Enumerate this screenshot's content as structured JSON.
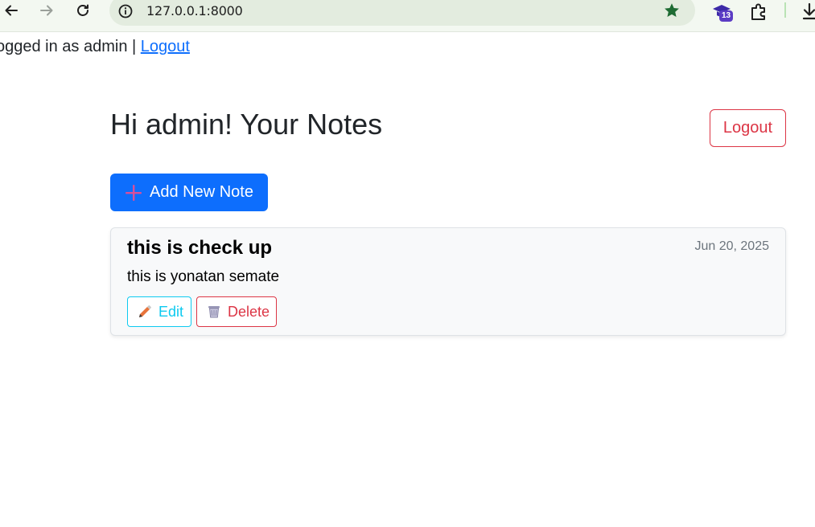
{
  "browser": {
    "url": "127.0.0.1:8000",
    "extension_badge": "13",
    "icons": [
      "back-arrow-icon",
      "forward-arrow-icon",
      "reload-icon",
      "info-icon",
      "bookmark-star-icon",
      "extension-graduation-icon",
      "puzzle-extensions-icon",
      "download-icon"
    ]
  },
  "header": {
    "status_text": "ogged in as admin | ",
    "logout_link": "Logout"
  },
  "main": {
    "title": "Hi admin! Your Notes",
    "logout_button": "Logout",
    "add_button": "Add New Note",
    "add_icon": "plus-icon"
  },
  "notes": [
    {
      "title": "this is check up",
      "date": "Jun 20, 2025",
      "body": "this is yonatan semate",
      "edit_label": "Edit",
      "edit_icon": "pencil-icon",
      "delete_label": "Delete",
      "delete_icon": "wastebasket-icon"
    }
  ],
  "colors": {
    "primary": "#0d6efd",
    "danger": "#dc3545",
    "info": "#0dcaf0",
    "muted": "#6c757d",
    "card_bg": "#f8f9fa"
  }
}
